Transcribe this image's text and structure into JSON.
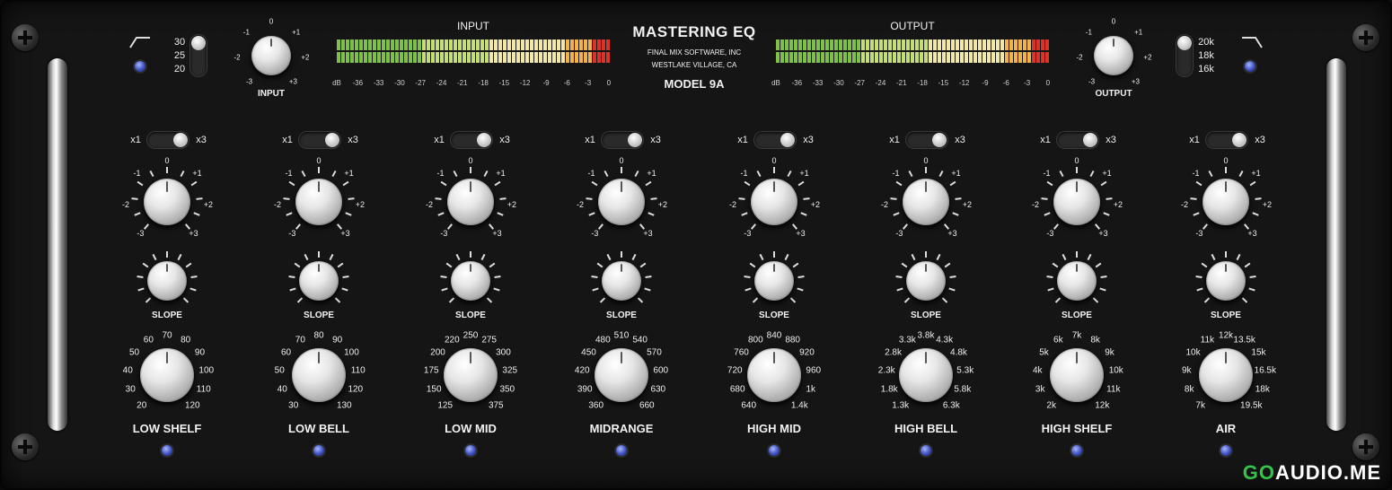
{
  "header": {
    "title": "MASTERING EQ",
    "company": "FINAL MIX SOFTWARE, INC",
    "location": "WESTLAKE VILLAGE, CA",
    "model": "MODEL 9A"
  },
  "input_meter": {
    "title": "INPUT",
    "scale": [
      "dB",
      "-36",
      "-33",
      "-30",
      "-27",
      "-24",
      "-21",
      "-18",
      "-15",
      "-12",
      "-9",
      "-6",
      "-3",
      "0"
    ]
  },
  "output_meter": {
    "title": "OUTPUT",
    "scale": [
      "dB",
      "-36",
      "-33",
      "-30",
      "-27",
      "-24",
      "-21",
      "-18",
      "-15",
      "-12",
      "-9",
      "-6",
      "-3",
      "0"
    ]
  },
  "input_knob": {
    "label": "INPUT",
    "scale": [
      "-1",
      "0",
      "+1",
      "-2",
      "+2",
      "-3",
      "+3"
    ]
  },
  "output_knob": {
    "label": "OUTPUT",
    "scale": [
      "-1",
      "0",
      "+1",
      "-2",
      "+2",
      "-3",
      "+3"
    ]
  },
  "hpf_switch": {
    "options": [
      "30",
      "25",
      "20"
    ]
  },
  "lpf_switch": {
    "options": [
      "20k",
      "18k",
      "16k"
    ]
  },
  "range_toggle": {
    "left": "x1",
    "right": "x3"
  },
  "gain_scale": [
    "-1",
    "0",
    "+1",
    "-2",
    "+2",
    "-3",
    "+3"
  ],
  "slope_label": "SLOPE",
  "bands": [
    {
      "name": "LOW SHELF",
      "freqs": [
        "20",
        "30",
        "40",
        "50",
        "60",
        "70",
        "80",
        "90",
        "100",
        "110",
        "120"
      ]
    },
    {
      "name": "LOW BELL",
      "freqs": [
        "30",
        "40",
        "50",
        "60",
        "70",
        "80",
        "90",
        "100",
        "110",
        "120",
        "130"
      ]
    },
    {
      "name": "LOW MID",
      "freqs": [
        "125",
        "150",
        "175",
        "200",
        "220",
        "250",
        "275",
        "300",
        "325",
        "350",
        "375"
      ]
    },
    {
      "name": "MIDRANGE",
      "freqs": [
        "360",
        "390",
        "420",
        "450",
        "480",
        "510",
        "540",
        "570",
        "600",
        "630",
        "660"
      ]
    },
    {
      "name": "HIGH MID",
      "freqs": [
        "640",
        "680",
        "720",
        "760",
        "800",
        "840",
        "880",
        "920",
        "960",
        "1k",
        "1.4k"
      ]
    },
    {
      "name": "HIGH BELL",
      "freqs": [
        "1.3k",
        "1.8k",
        "2.3k",
        "2.8k",
        "3.3k",
        "3.8k",
        "4.3k",
        "4.8k",
        "5.3k",
        "5.8k",
        "6.3k"
      ]
    },
    {
      "name": "HIGH SHELF",
      "freqs": [
        "2k",
        "3k",
        "4k",
        "5k",
        "6k",
        "7k",
        "8k",
        "9k",
        "10k",
        "11k",
        "12k"
      ]
    },
    {
      "name": "AIR",
      "freqs": [
        "7k",
        "8k",
        "9k",
        "10k",
        "11k",
        "12k",
        "13.5k",
        "15k",
        "16.5k",
        "18k",
        "19.5k"
      ]
    }
  ],
  "watermark": {
    "prefix": "GO",
    "main": "AUDIO.ME"
  }
}
